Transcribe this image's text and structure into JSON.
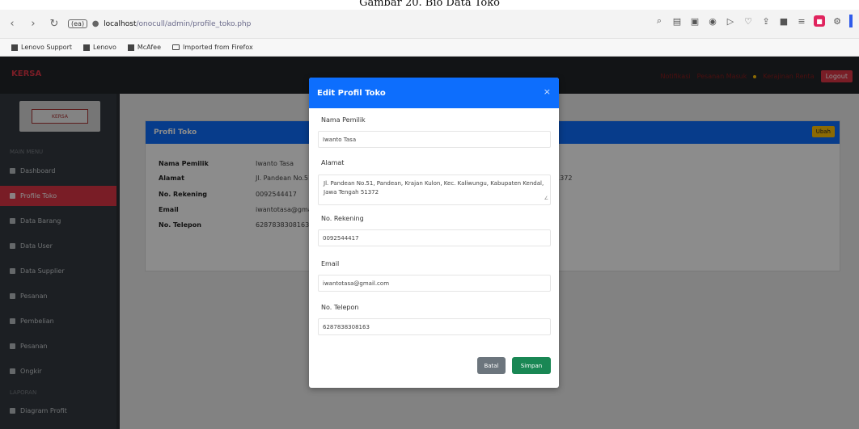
{
  "caption": "Gambar 20. Bio Data Toko",
  "browser": {
    "url_badge": "(ea)",
    "url_host": "localhost",
    "url_path": "/onocull/admin/profile_toko.php",
    "bookmarks": [
      "Lenovo Support",
      "Lenovo",
      "McAfee",
      "Imported from Firefox"
    ]
  },
  "app": {
    "brand": "KERSA",
    "nav_links": [
      "Notifikasi",
      "Pesanan Masuk",
      "Kerajinan Renta"
    ],
    "logout_label": "Logout",
    "logo_text": "KERSA",
    "sidebar": {
      "heading1": "MAIN MENU",
      "items": [
        {
          "label": "Dashboard",
          "active": false
        },
        {
          "label": "Profile Toko",
          "active": true
        },
        {
          "label": "Data Barang",
          "active": false
        },
        {
          "label": "Data User",
          "active": false
        },
        {
          "label": "Data Supplier",
          "active": false
        },
        {
          "label": "Pesanan",
          "active": false
        },
        {
          "label": "Pembelian",
          "active": false
        },
        {
          "label": "Pesanan",
          "active": false
        },
        {
          "label": "Ongkir",
          "active": false
        }
      ],
      "heading2": "LAPORAN",
      "report_item": "Diagram Profit"
    },
    "profile_card": {
      "title": "Profil Toko",
      "edit_label": "Ubah",
      "rows": [
        {
          "label": "Nama Pemilik",
          "value": "Iwanto Tasa"
        },
        {
          "label": "Alamat",
          "value": "Jl. Pandean No.51, Pandean, Krajan Kulon, Kec. Kaliwungu, Kabupaten Kendal, Jawa Tengah 51372"
        },
        {
          "label": "No. Rekening",
          "value": "0092544417"
        },
        {
          "label": "Email",
          "value": "iwantotasa@gmail.com"
        },
        {
          "label": "No. Telepon",
          "value": "6287838308163"
        }
      ]
    }
  },
  "modal": {
    "title": "Edit Profil Toko",
    "close_icon": "×",
    "fields": {
      "nama_label": "Nama Pemilik",
      "nama_value": "Iwanto Tasa",
      "alamat_label": "Alamat",
      "alamat_value": "Jl. Pandean No.51, Pandean, Krajan Kulon, Kec. Kaliwungu, Kabupaten Kendal, Jawa Tengah 51372",
      "rekening_label": "No. Rekening",
      "rekening_value": "0092544417",
      "email_label": "Email",
      "email_value": "iwantotasa@gmail.com",
      "telepon_label": "No. Telepon",
      "telepon_value": "6287838308163"
    },
    "cancel_label": "Batal",
    "save_label": "Simpan"
  }
}
